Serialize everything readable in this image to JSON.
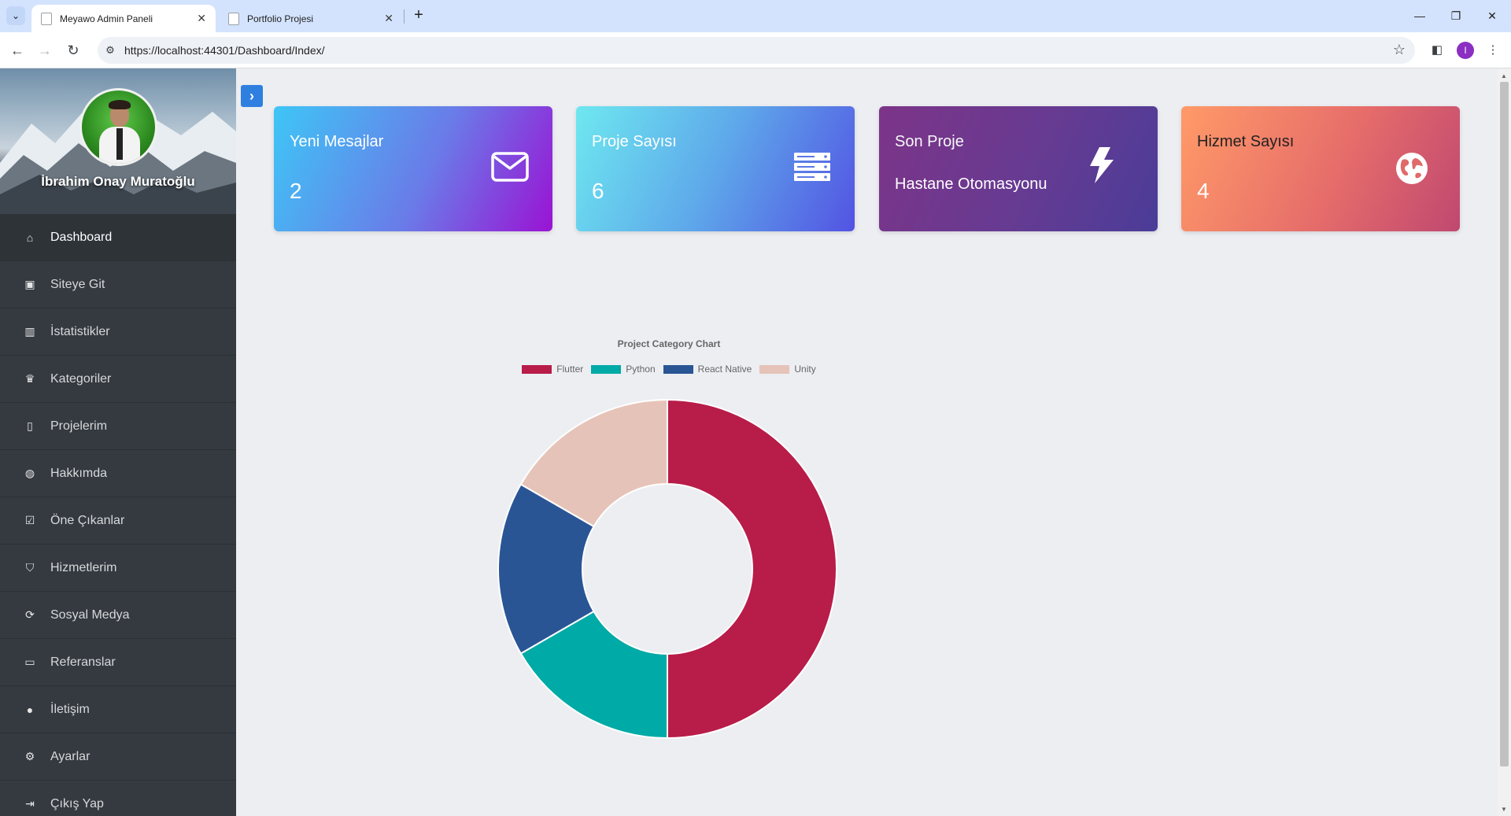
{
  "browser": {
    "tabs": [
      {
        "title": "Meyawo Admin Paneli",
        "active": true
      },
      {
        "title": "Portfolio Projesi",
        "active": false
      }
    ],
    "url": "https://localhost:44301/Dashboard/Index/",
    "profile_initial": "I"
  },
  "sidebar": {
    "user_name": "İbrahim Onay Muratoğlu",
    "items": [
      {
        "label": "Dashboard",
        "icon": "home-icon",
        "glyph": "⌂",
        "active": true
      },
      {
        "label": "Siteye Git",
        "icon": "gift-icon",
        "glyph": "▣"
      },
      {
        "label": "İstatistikler",
        "icon": "bar-chart-icon",
        "glyph": "▥"
      },
      {
        "label": "Kategoriler",
        "icon": "trophy-icon",
        "glyph": "♛"
      },
      {
        "label": "Projelerim",
        "icon": "mobile-icon",
        "glyph": "▯"
      },
      {
        "label": "Hakkımda",
        "icon": "globe-icon",
        "glyph": "◍"
      },
      {
        "label": "Öne Çıkanlar",
        "icon": "check-square-icon",
        "glyph": "☑"
      },
      {
        "label": "Hizmetlerim",
        "icon": "shield-icon",
        "glyph": "⛉"
      },
      {
        "label": "Sosyal Medya",
        "icon": "refresh-icon",
        "glyph": "⟳"
      },
      {
        "label": "Referanslar",
        "icon": "battery-icon",
        "glyph": "▭"
      },
      {
        "label": "İletişim",
        "icon": "user-icon",
        "glyph": "●"
      },
      {
        "label": "Ayarlar",
        "icon": "gear-icon",
        "glyph": "⚙"
      },
      {
        "label": "Çıkış Yap",
        "icon": "sign-out-icon",
        "glyph": "⇥"
      }
    ]
  },
  "cards": [
    {
      "title": "Yeni Mesajlar",
      "value": "2",
      "icon": "envelope-icon"
    },
    {
      "title": "Proje Sayısı",
      "value": "6",
      "icon": "server-icon"
    },
    {
      "title": "Son Proje",
      "value": "Hastane Otomasyonu",
      "icon": "bolt-icon"
    },
    {
      "title": "Hizmet Sayısı",
      "value": "4",
      "icon": "globe-icon"
    }
  ],
  "colors": {
    "sidebar_bg": "#343a40",
    "toggle_button": "#2f7fe1"
  },
  "chart_data": {
    "type": "pie",
    "variant": "doughnut",
    "title": "Project Category Chart",
    "categories": [
      "Flutter",
      "Python",
      "React Native",
      "Unity"
    ],
    "values": [
      3,
      1,
      1,
      1
    ],
    "colors": [
      "#b81c48",
      "#00aaa6",
      "#2a5595",
      "#e6c3b8"
    ],
    "legend_position": "top"
  }
}
